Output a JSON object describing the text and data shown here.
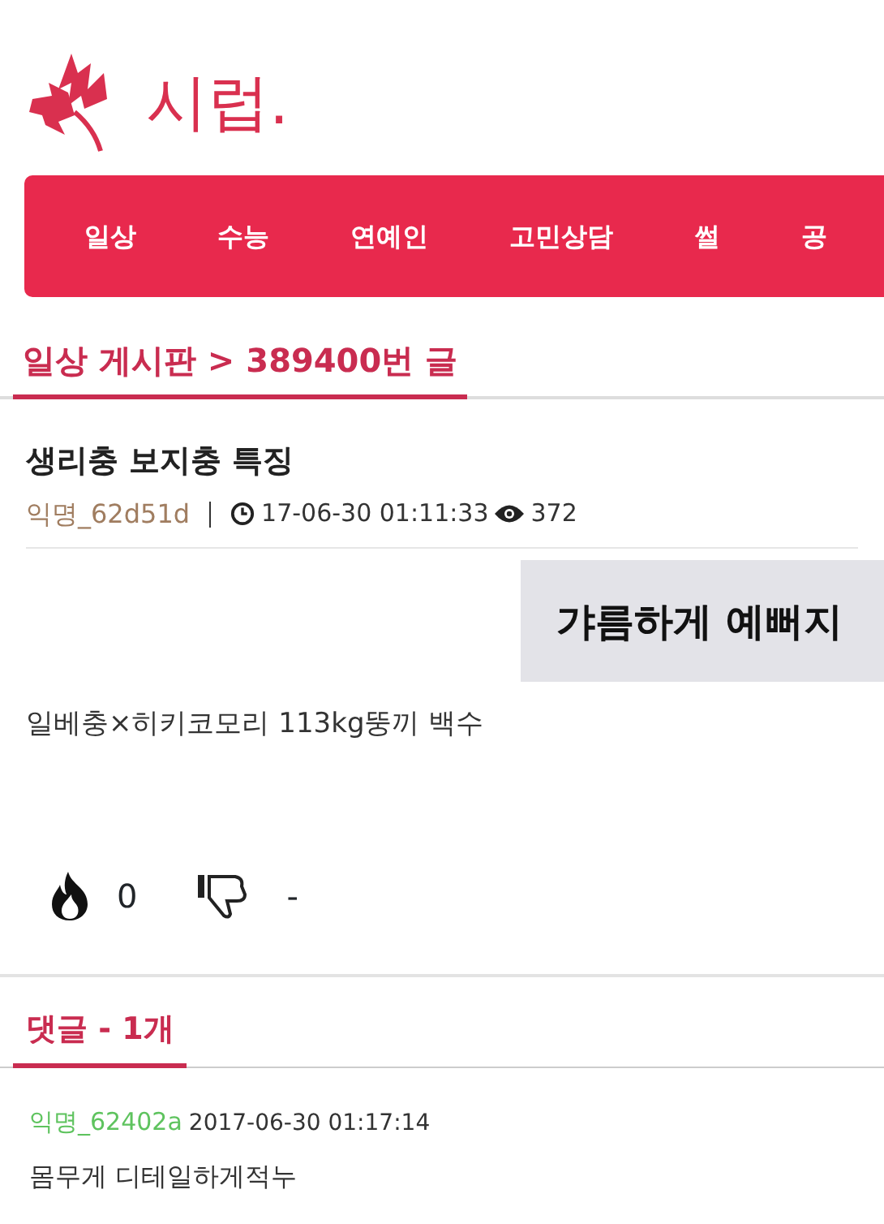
{
  "logo": {
    "text": "시럽."
  },
  "nav": [
    {
      "label": "일상"
    },
    {
      "label": "수능"
    },
    {
      "label": "연예인"
    },
    {
      "label": "고민상담"
    },
    {
      "label": "썰"
    },
    {
      "label": "공"
    }
  ],
  "breadcrumb": "일상 게시판 > 389400번 글",
  "post": {
    "title": "생리충 보지충 특징",
    "author": "익명_62d51d",
    "date": "17-06-30 01:11:33",
    "views": "372",
    "image_text": "갸름하게 예뻐지",
    "body": "일베충×히키코모리 113kg뚱끼 백수",
    "likes": "0",
    "dislikes": "-"
  },
  "comments_heading": "댓글 - 1개",
  "comments": [
    {
      "author": "익명_62402a",
      "date": "2017-06-30 01:17:14",
      "text": "몸무게 디테일하게적누"
    }
  ]
}
